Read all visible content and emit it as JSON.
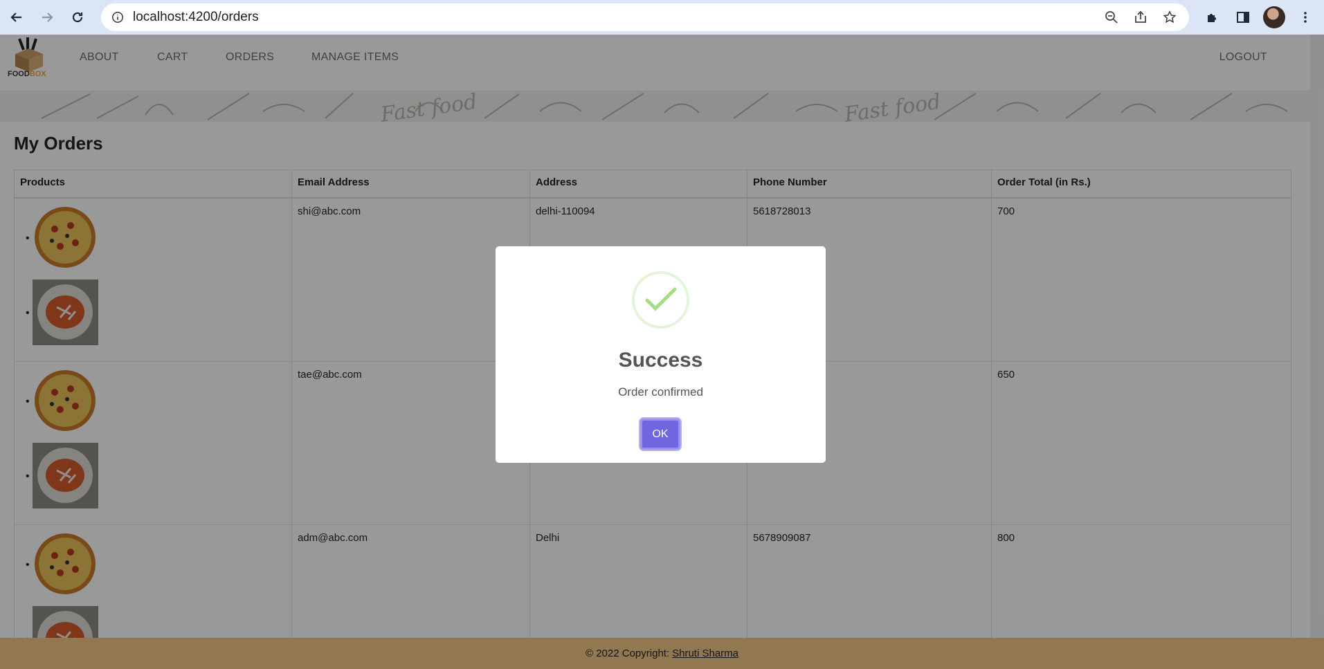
{
  "browser": {
    "url": "localhost:4200/orders"
  },
  "navbar": {
    "logo_food": "FOOD",
    "logo_box": "BOX",
    "links": [
      "ABOUT",
      "CART",
      "ORDERS",
      "MANAGE ITEMS"
    ],
    "logout": "LOGOUT"
  },
  "banner": {
    "text": "Fast food"
  },
  "orders": {
    "title": "My Orders",
    "columns": [
      "Products",
      "Email Address",
      "Address",
      "Phone Number",
      "Order Total (in Rs.)"
    ],
    "rows": [
      {
        "email": "shi@abc.com",
        "address": "delhi-110094",
        "phone": "5618728013",
        "total": "700",
        "products": [
          "pizza",
          "pasta"
        ]
      },
      {
        "email": "tae@abc.com",
        "address": "",
        "phone": "",
        "total": "650",
        "products": [
          "pizza",
          "pasta"
        ]
      },
      {
        "email": "adm@abc.com",
        "address": "Delhi",
        "phone": "5678909087",
        "total": "800",
        "products": [
          "pizza",
          "pasta"
        ]
      }
    ]
  },
  "footer": {
    "copyright": "© 2022 Copyright:",
    "author": "Shruti Sharma"
  },
  "modal": {
    "title": "Success",
    "message": "Order confirmed",
    "ok_label": "OK",
    "icon": "success-check-icon"
  },
  "colors": {
    "accent": "#7066e0",
    "success": "#a5dc86",
    "footer": "#f3c887"
  }
}
